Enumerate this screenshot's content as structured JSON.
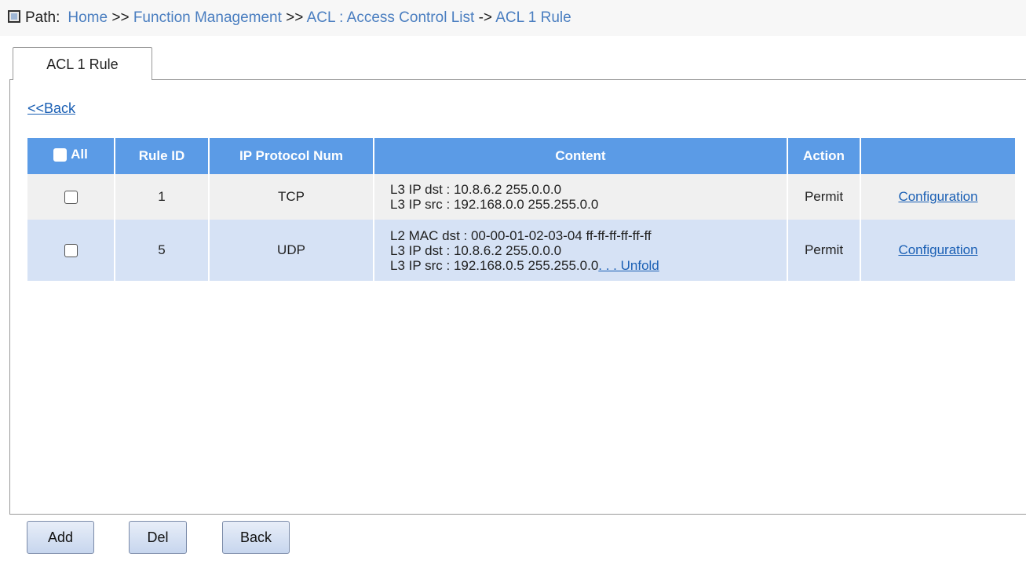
{
  "path": {
    "label": "Path:",
    "crumbs": [
      "Home",
      "Function Management",
      "ACL : Access Control List",
      "ACL 1 Rule"
    ],
    "separators": [
      ">>",
      ">>",
      "->"
    ]
  },
  "tab": {
    "label": "ACL 1 Rule"
  },
  "back_link": "<<Back",
  "table": {
    "headers": {
      "all": "All",
      "rule_id": "Rule ID",
      "ip_protocol": "IP Protocol Num",
      "content": "Content",
      "action": "Action",
      "config": ""
    },
    "rows": [
      {
        "rule_id": "1",
        "protocol": "TCP",
        "content": [
          "L3 IP dst : 10.8.6.2 255.0.0.0",
          "L3 IP src : 192.168.0.0 255.255.0.0"
        ],
        "action": "Permit",
        "config_link": "Configuration"
      },
      {
        "rule_id": "5",
        "protocol": "UDP",
        "content": [
          "L2 MAC dst : 00-00-01-02-03-04 ff-ff-ff-ff-ff-ff",
          "L3 IP dst : 10.8.6.2 255.0.0.0",
          "L3 IP src : 192.168.0.5 255.255.0.0"
        ],
        "unfold": ". . . Unfold",
        "action": "Permit",
        "config_link": "Configuration"
      }
    ]
  },
  "buttons": {
    "add": "Add",
    "del": "Del",
    "back": "Back"
  }
}
